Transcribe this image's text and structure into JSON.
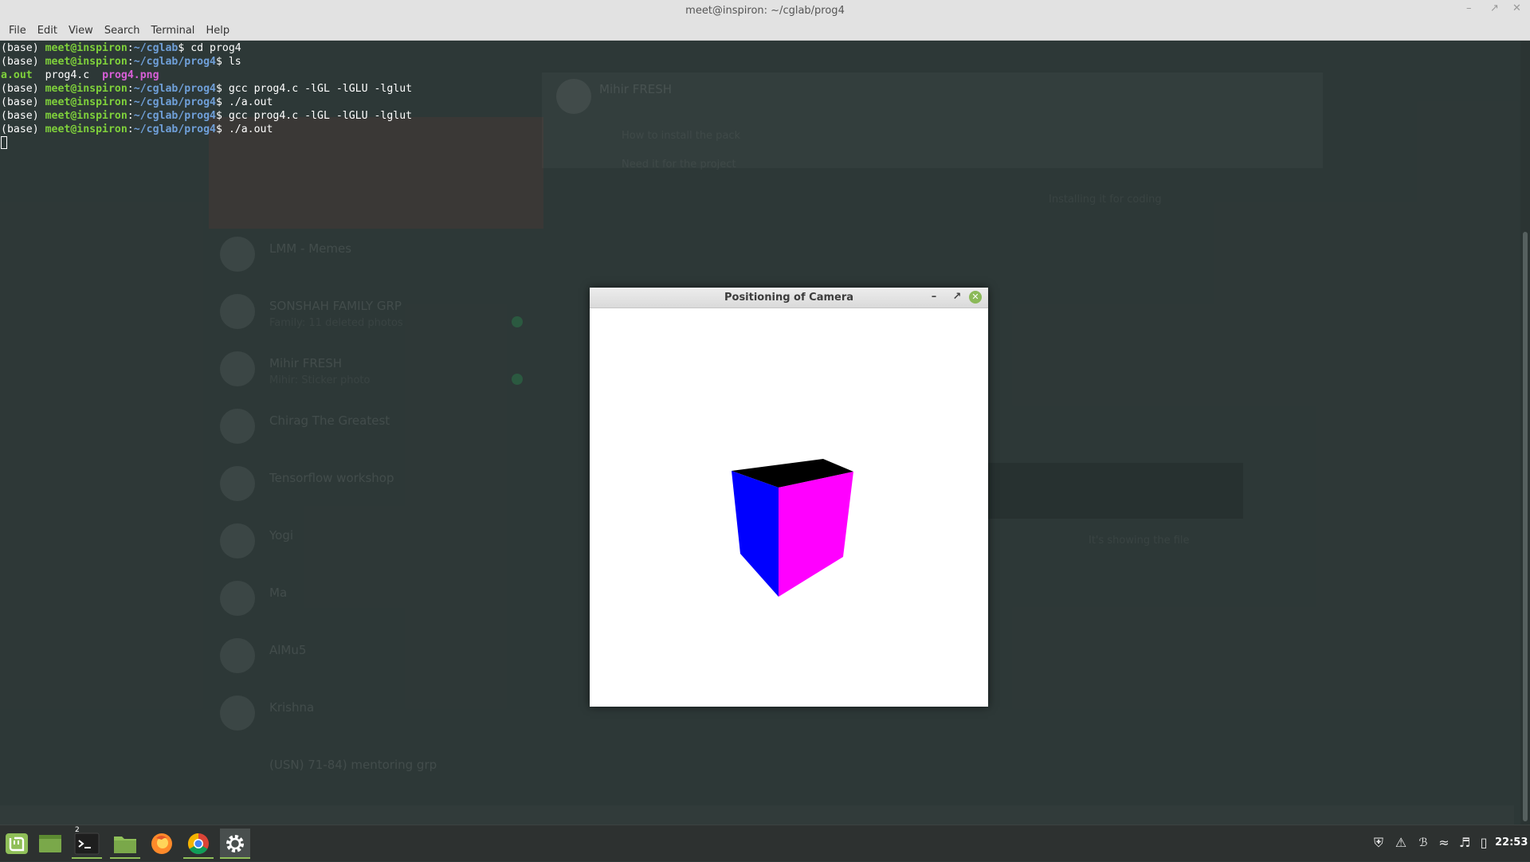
{
  "terminal": {
    "title": "meet@inspiron: ~/cglab/prog4",
    "menu": [
      "File",
      "Edit",
      "View",
      "Search",
      "Terminal",
      "Help"
    ],
    "lines": [
      {
        "kind": "prompt",
        "env": "(base) ",
        "user": "meet@inspiron",
        "sep": ":",
        "path": "~/cglab",
        "cmd": "$ cd prog4"
      },
      {
        "kind": "prompt",
        "env": "(base) ",
        "user": "meet@inspiron",
        "sep": ":",
        "path": "~/cglab/prog4",
        "cmd": "$ ls"
      },
      {
        "kind": "ls",
        "items": [
          {
            "name": "a.out",
            "type": "exe"
          },
          {
            "name": "prog4.c",
            "type": "file"
          },
          {
            "name": "prog4.png",
            "type": "img"
          }
        ]
      },
      {
        "kind": "prompt",
        "env": "(base) ",
        "user": "meet@inspiron",
        "sep": ":",
        "path": "~/cglab/prog4",
        "cmd": "$ gcc prog4.c -lGL -lGLU -lglut"
      },
      {
        "kind": "prompt",
        "env": "(base) ",
        "user": "meet@inspiron",
        "sep": ":",
        "path": "~/cglab/prog4",
        "cmd": "$ ./a.out"
      },
      {
        "kind": "prompt",
        "env": "(base) ",
        "user": "meet@inspiron",
        "sep": ":",
        "path": "~/cglab/prog4",
        "cmd": "$ gcc prog4.c -lGL -lGLU -lglut"
      },
      {
        "kind": "prompt",
        "env": "(base) ",
        "user": "meet@inspiron",
        "sep": ":",
        "path": "~/cglab/prog4",
        "cmd": "$ ./a.out"
      }
    ]
  },
  "background_app": {
    "chats": [
      {
        "name": "LMM - Memes"
      },
      {
        "name": "SONSHAH FAMILY GRP",
        "preview": "Family: 11 deleted photos"
      },
      {
        "name": "Mihir FRESH",
        "preview": "Mihir: Sticker photo"
      },
      {
        "name": "Chirag The Greatest"
      },
      {
        "name": "Tensorflow workshop"
      },
      {
        "name": "Yogi"
      },
      {
        "name": "Ma"
      },
      {
        "name": "AlMu5"
      },
      {
        "name": "Krishna"
      },
      {
        "name": "(USN) 71-84) mentoring grp"
      }
    ],
    "header_name": "Mihir FRESH",
    "msgs": [
      "How to install the pack",
      "Need it for the project",
      "Installing it for coding",
      "It's showing the file"
    ]
  },
  "gl_window": {
    "title": "Positioning of Camera",
    "colors": {
      "background": "#ffffff",
      "top_face": "#000000",
      "left_face": "#0000ff",
      "right_face": "#ff00ff"
    }
  },
  "taskbar": {
    "apps": [
      "mint-menu-icon",
      "show-desktop-icon",
      "terminal-icon",
      "files-icon",
      "firefox-icon",
      "chrome-icon",
      "settings-icon"
    ],
    "terminal_badge": "2",
    "clock": "22:53",
    "tray": [
      "shield-icon",
      "warning-icon",
      "bluetooth-icon",
      "wifi-icon",
      "volume-icon",
      "battery-icon"
    ]
  }
}
